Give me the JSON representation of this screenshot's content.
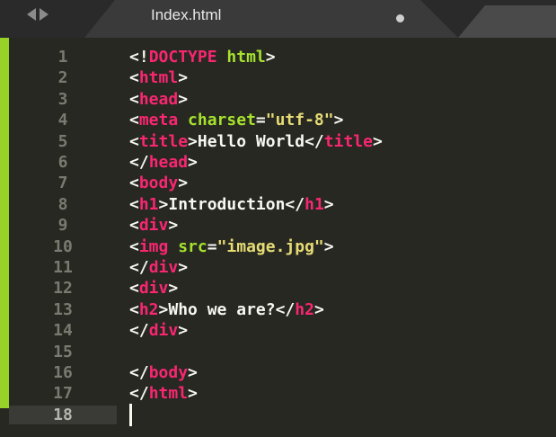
{
  "tab": {
    "filename": "Index.html"
  },
  "colors": {
    "background": "#272822",
    "tag": "#f92672",
    "attribute": "#a6e22e",
    "string": "#e6db74",
    "text": "#f8f8f2",
    "gutter_marker": "#98d228"
  },
  "lines": [
    {
      "num": "1",
      "tokens": [
        [
          "p",
          "<!"
        ],
        [
          "t",
          "DOCTYPE"
        ],
        [
          "p",
          " "
        ],
        [
          "a",
          "html"
        ],
        [
          "p",
          ">"
        ]
      ]
    },
    {
      "num": "2",
      "tokens": [
        [
          "p",
          "<"
        ],
        [
          "t",
          "html"
        ],
        [
          "p",
          ">"
        ]
      ]
    },
    {
      "num": "3",
      "tokens": [
        [
          "p",
          "<"
        ],
        [
          "t",
          "head"
        ],
        [
          "p",
          ">"
        ]
      ]
    },
    {
      "num": "4",
      "tokens": [
        [
          "p",
          "<"
        ],
        [
          "t",
          "meta"
        ],
        [
          "p",
          " "
        ],
        [
          "a",
          "charset"
        ],
        [
          "p",
          "="
        ],
        [
          "s",
          "\"utf-8\""
        ],
        [
          "p",
          ">"
        ]
      ]
    },
    {
      "num": "5",
      "tokens": [
        [
          "p",
          "<"
        ],
        [
          "t",
          "title"
        ],
        [
          "p",
          ">"
        ],
        [
          "x",
          "Hello World"
        ],
        [
          "p",
          "</"
        ],
        [
          "t",
          "title"
        ],
        [
          "p",
          ">"
        ]
      ]
    },
    {
      "num": "6",
      "tokens": [
        [
          "p",
          "</"
        ],
        [
          "t",
          "head"
        ],
        [
          "p",
          ">"
        ]
      ]
    },
    {
      "num": "7",
      "tokens": [
        [
          "p",
          "<"
        ],
        [
          "t",
          "body"
        ],
        [
          "p",
          ">"
        ]
      ]
    },
    {
      "num": "8",
      "tokens": [
        [
          "p",
          "<"
        ],
        [
          "t",
          "h1"
        ],
        [
          "p",
          ">"
        ],
        [
          "x",
          "Introduction"
        ],
        [
          "p",
          "</"
        ],
        [
          "t",
          "h1"
        ],
        [
          "p",
          ">"
        ]
      ]
    },
    {
      "num": "9",
      "tokens": [
        [
          "p",
          "<"
        ],
        [
          "t",
          "div"
        ],
        [
          "p",
          ">"
        ]
      ]
    },
    {
      "num": "10",
      "tokens": [
        [
          "p",
          "<"
        ],
        [
          "t",
          "img"
        ],
        [
          "p",
          " "
        ],
        [
          "a",
          "src"
        ],
        [
          "p",
          "="
        ],
        [
          "s",
          "\"image.jpg\""
        ],
        [
          "p",
          ">"
        ]
      ]
    },
    {
      "num": "11",
      "tokens": [
        [
          "p",
          "</"
        ],
        [
          "t",
          "div"
        ],
        [
          "p",
          ">"
        ]
      ]
    },
    {
      "num": "12",
      "tokens": [
        [
          "p",
          "<"
        ],
        [
          "t",
          "div"
        ],
        [
          "p",
          ">"
        ]
      ]
    },
    {
      "num": "13",
      "tokens": [
        [
          "p",
          "<"
        ],
        [
          "t",
          "h2"
        ],
        [
          "p",
          ">"
        ],
        [
          "x",
          "Who we are?"
        ],
        [
          "p",
          "</"
        ],
        [
          "t",
          "h2"
        ],
        [
          "p",
          ">"
        ]
      ]
    },
    {
      "num": "14",
      "tokens": [
        [
          "p",
          "</"
        ],
        [
          "t",
          "div"
        ],
        [
          "p",
          ">"
        ]
      ]
    },
    {
      "num": "15",
      "tokens": []
    },
    {
      "num": "16",
      "tokens": [
        [
          "p",
          "</"
        ],
        [
          "t",
          "body"
        ],
        [
          "p",
          ">"
        ]
      ]
    },
    {
      "num": "17",
      "tokens": [
        [
          "p",
          "</"
        ],
        [
          "t",
          "html"
        ],
        [
          "p",
          ">"
        ]
      ]
    },
    {
      "num": "18",
      "tokens": [],
      "current": true
    }
  ]
}
